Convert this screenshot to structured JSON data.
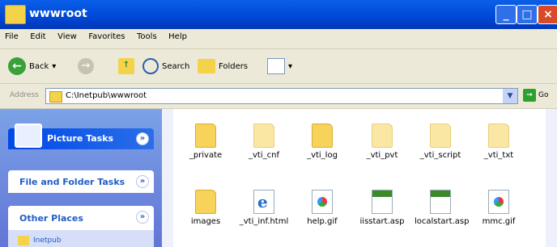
{
  "window": {
    "title": "wwwroot"
  },
  "menu": [
    "File",
    "Edit",
    "View",
    "Favorites",
    "Tools",
    "Help"
  ],
  "toolbar": {
    "back": "Back",
    "search": "Search",
    "folders": "Folders"
  },
  "address": {
    "label": "Address",
    "path": "C:\\Inetpub\\wwwroot",
    "go": "Go"
  },
  "left_pane": {
    "groups": [
      {
        "title": "Picture Tasks",
        "toggle": "»"
      },
      {
        "title": "File and Folder Tasks",
        "toggle": "»"
      },
      {
        "title": "Other Places",
        "toggle": "»"
      }
    ],
    "places": [
      "Inetpub"
    ]
  },
  "files": [
    {
      "name": "_private",
      "type": "folder"
    },
    {
      "name": "_vti_cnf",
      "type": "folder-light"
    },
    {
      "name": "_vti_log",
      "type": "folder"
    },
    {
      "name": "_vti_pvt",
      "type": "folder-light"
    },
    {
      "name": "_vti_script",
      "type": "folder-light"
    },
    {
      "name": "_vti_txt",
      "type": "folder-light"
    },
    {
      "name": "images",
      "type": "folder"
    },
    {
      "name": "_vti_inf.html",
      "type": "ie"
    },
    {
      "name": "help.gif",
      "type": "gif"
    },
    {
      "name": "iisstart.asp",
      "type": "asp"
    },
    {
      "name": "localstart.asp",
      "type": "asp"
    },
    {
      "name": "mmc.gif",
      "type": "gif"
    }
  ]
}
